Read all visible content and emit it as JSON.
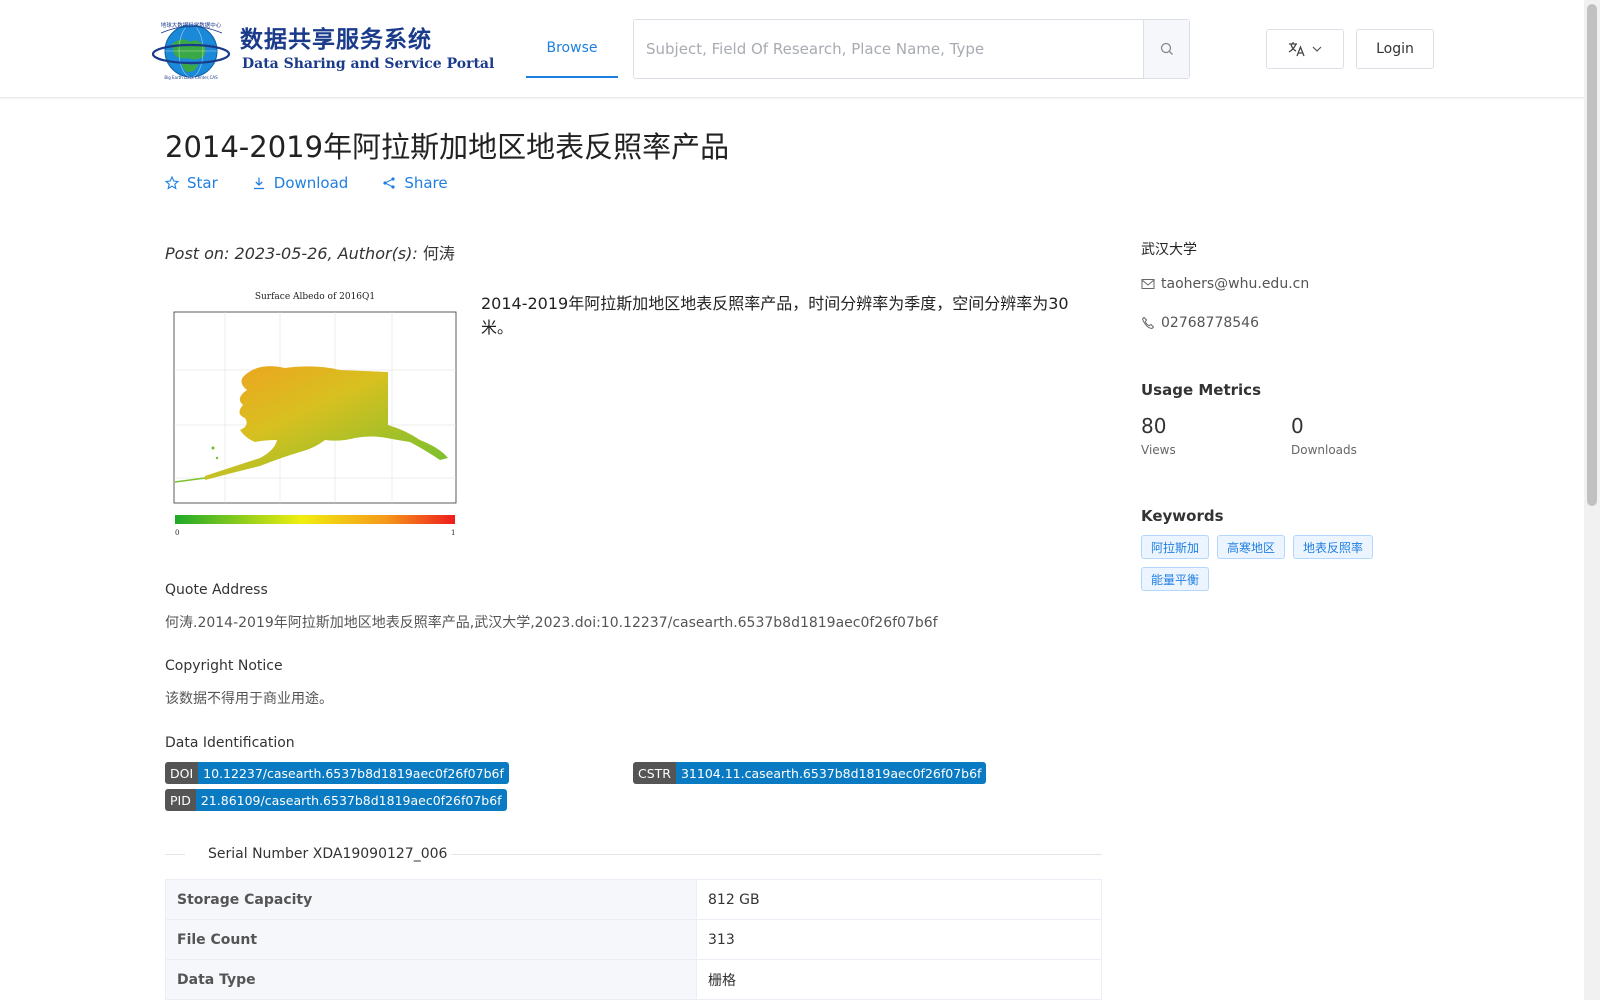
{
  "header": {
    "logo_cn": "数据共享服务系统",
    "logo_en": "Data Sharing and Service Portal",
    "logo_ring_text": "地球大数据科学数据中心",
    "logo_ring_text_en": "Big Earth Data Center,CAS",
    "nav_browse": "Browse",
    "search_placeholder": "Subject, Field Of Research, Place Name, Type",
    "language_icon": "translate-icon",
    "login": "Login"
  },
  "dataset": {
    "title": "2014-2019年阿拉斯加地区地表反照率产品",
    "actions": {
      "star": "Star",
      "download": "Download",
      "share": "Share"
    },
    "post_on_label": "Post on: 2023-05-26, Author(s):",
    "author": "何涛",
    "thumbnail": {
      "title": "Surface Albedo of 2016Q1",
      "scale_min": "0",
      "scale_max": "1"
    },
    "description": "2014-2019年阿拉斯加地区地表反照率产品，时间分辨率为季度，空间分辨率为30米。",
    "quote_label": "Quote Address",
    "quote_text": "何涛.2014-2019年阿拉斯加地区地表反照率产品,武汉大学,2023.doi:10.12237/casearth.6537b8d1819aec0f26f07b6f",
    "copyright_label": "Copyright Notice",
    "copyright_text": "该数据不得用于商业用途。",
    "identification_label": "Data Identification",
    "identifiers": {
      "doi_key": "DOI",
      "doi_val": "10.12237/casearth.6537b8d1819aec0f26f07b6f",
      "cstr_key": "CSTR",
      "cstr_val": "31104.11.casearth.6537b8d1819aec0f26f07b6f",
      "pid_key": "PID",
      "pid_val": "21.86109/casearth.6537b8d1819aec0f26f07b6f"
    },
    "serial_number": "Serial Number XDA19090127_006",
    "info_table": [
      {
        "key": "Storage Capacity",
        "value": "812 GB"
      },
      {
        "key": "File Count",
        "value": "313"
      },
      {
        "key": "Data Type",
        "value": "栅格"
      }
    ]
  },
  "sidebar": {
    "organization": "武汉大学",
    "email": "taohers@whu.edu.cn",
    "phone": "02768778546",
    "usage_label": "Usage Metrics",
    "views_value": "80",
    "views_label": "Views",
    "downloads_value": "0",
    "downloads_label": "Downloads",
    "keywords_label": "Keywords",
    "keywords": [
      "阿拉斯加",
      "高寒地区",
      "地表反照率",
      "能量平衡"
    ]
  },
  "colors": {
    "accent": "#1f7fe0",
    "badge_key": "#555555",
    "badge_value": "#0a7bc2",
    "logo": "#1a3a8a"
  }
}
